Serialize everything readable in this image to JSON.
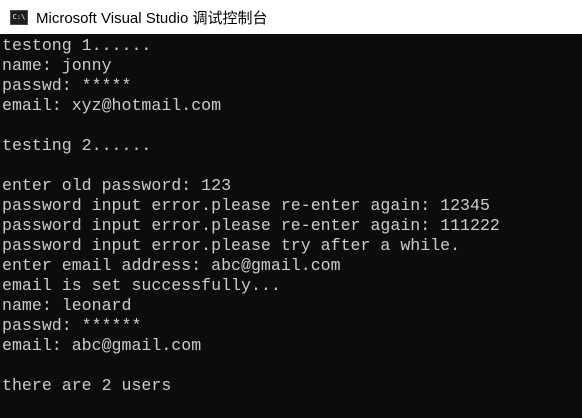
{
  "window": {
    "title": "Microsoft Visual Studio 调试控制台",
    "icon_text": "C:\\"
  },
  "console": {
    "lines": [
      "testong 1......",
      "name: jonny",
      "passwd: *****",
      "email: xyz@hotmail.com",
      "",
      "testing 2......",
      "",
      "enter old password: 123",
      "password input error.please re-enter again: 12345",
      "password input error.please re-enter again: 111222",
      "password input error.please try after a while.",
      "enter email address: abc@gmail.com",
      "email is set successfully...",
      "name: leonard",
      "passwd: ******",
      "email: abc@gmail.com",
      "",
      "there are 2 users"
    ]
  },
  "colors": {
    "console_background": "#0c0c0c",
    "console_text": "#cccccc",
    "titlebar_background": "#ffffff"
  }
}
